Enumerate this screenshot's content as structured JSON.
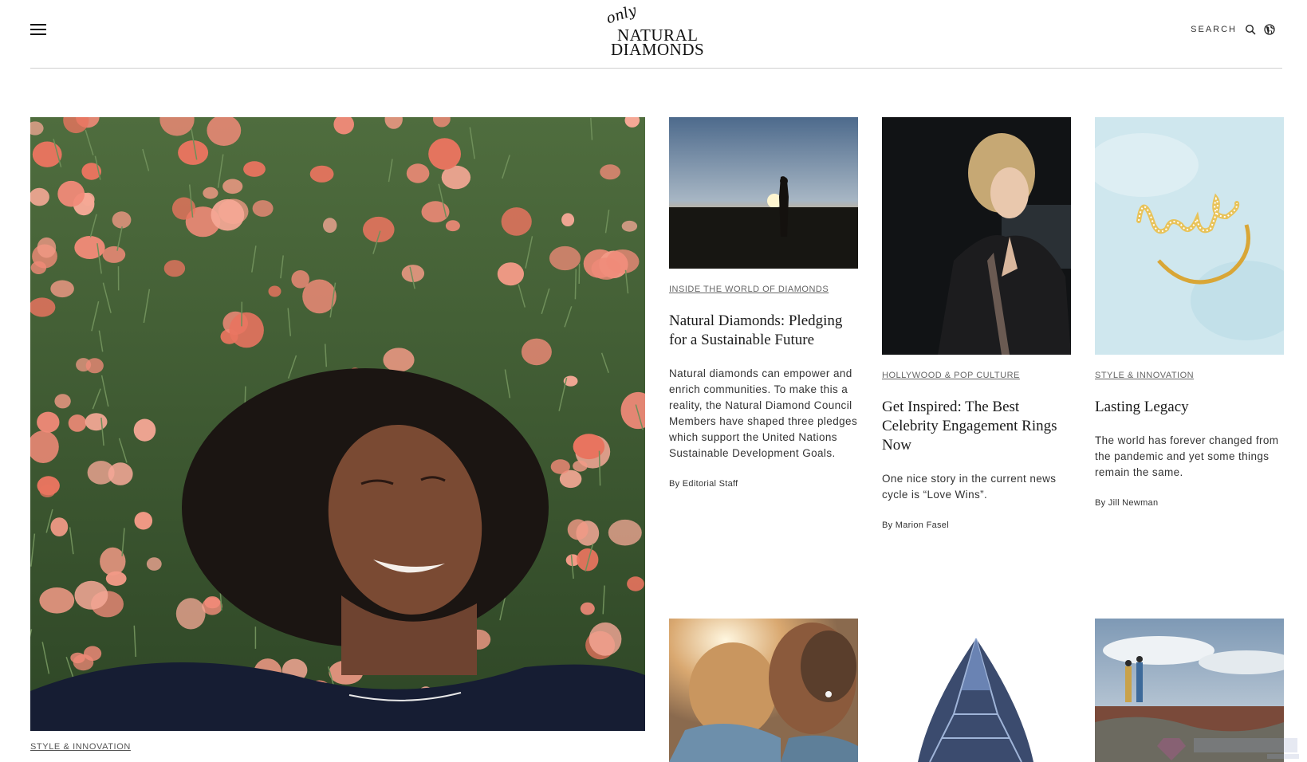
{
  "header": {
    "logo_script": "only",
    "logo_line1": "NATURAL",
    "logo_line2": "DIAMONDS",
    "search_label": "SEARCH"
  },
  "hero": {
    "category": "STYLE & INNOVATION",
    "image_icon": "photo-woman-in-flowers"
  },
  "cards": [
    {
      "category": "INSIDE THE WORLD OF DIAMONDS",
      "title": "Natural Diamonds: Pledging for a Sustainable Future",
      "excerpt": "Natural diamonds can empower and enrich communities. To make this a reality, the Natural Diamond Council Members have shaped three pledges which support the United Nations Sustainable Development Goals.",
      "byline": "By Editorial Staff",
      "image_icon": "photo-sunset-silhouette"
    },
    {
      "category": "HOLLYWOOD & POP CULTURE",
      "title": "Get Inspired: The Best Celebrity Engagement Rings Now",
      "excerpt": "One nice story in the current news cycle is “Love Wins”.",
      "byline": "By Marion Fasel",
      "image_icon": "photo-celebrity"
    },
    {
      "category": "STYLE & INNOVATION",
      "title": "Lasting Legacy",
      "excerpt": "The world has forever changed from the pandemic and yet some things remain the same.",
      "byline": "By Jill Newman",
      "image_icon": "photo-love-ring"
    }
  ],
  "row2": [
    {
      "image_icon": "photo-couple-kissing"
    },
    {
      "image_icon": "photo-blue-diamond"
    },
    {
      "image_icon": "photo-hikers-landscape"
    }
  ],
  "colors": {
    "text": "#222222",
    "divider": "#cfcfcf",
    "flower": "#f08a78",
    "foliage": "#3d5a32"
  }
}
